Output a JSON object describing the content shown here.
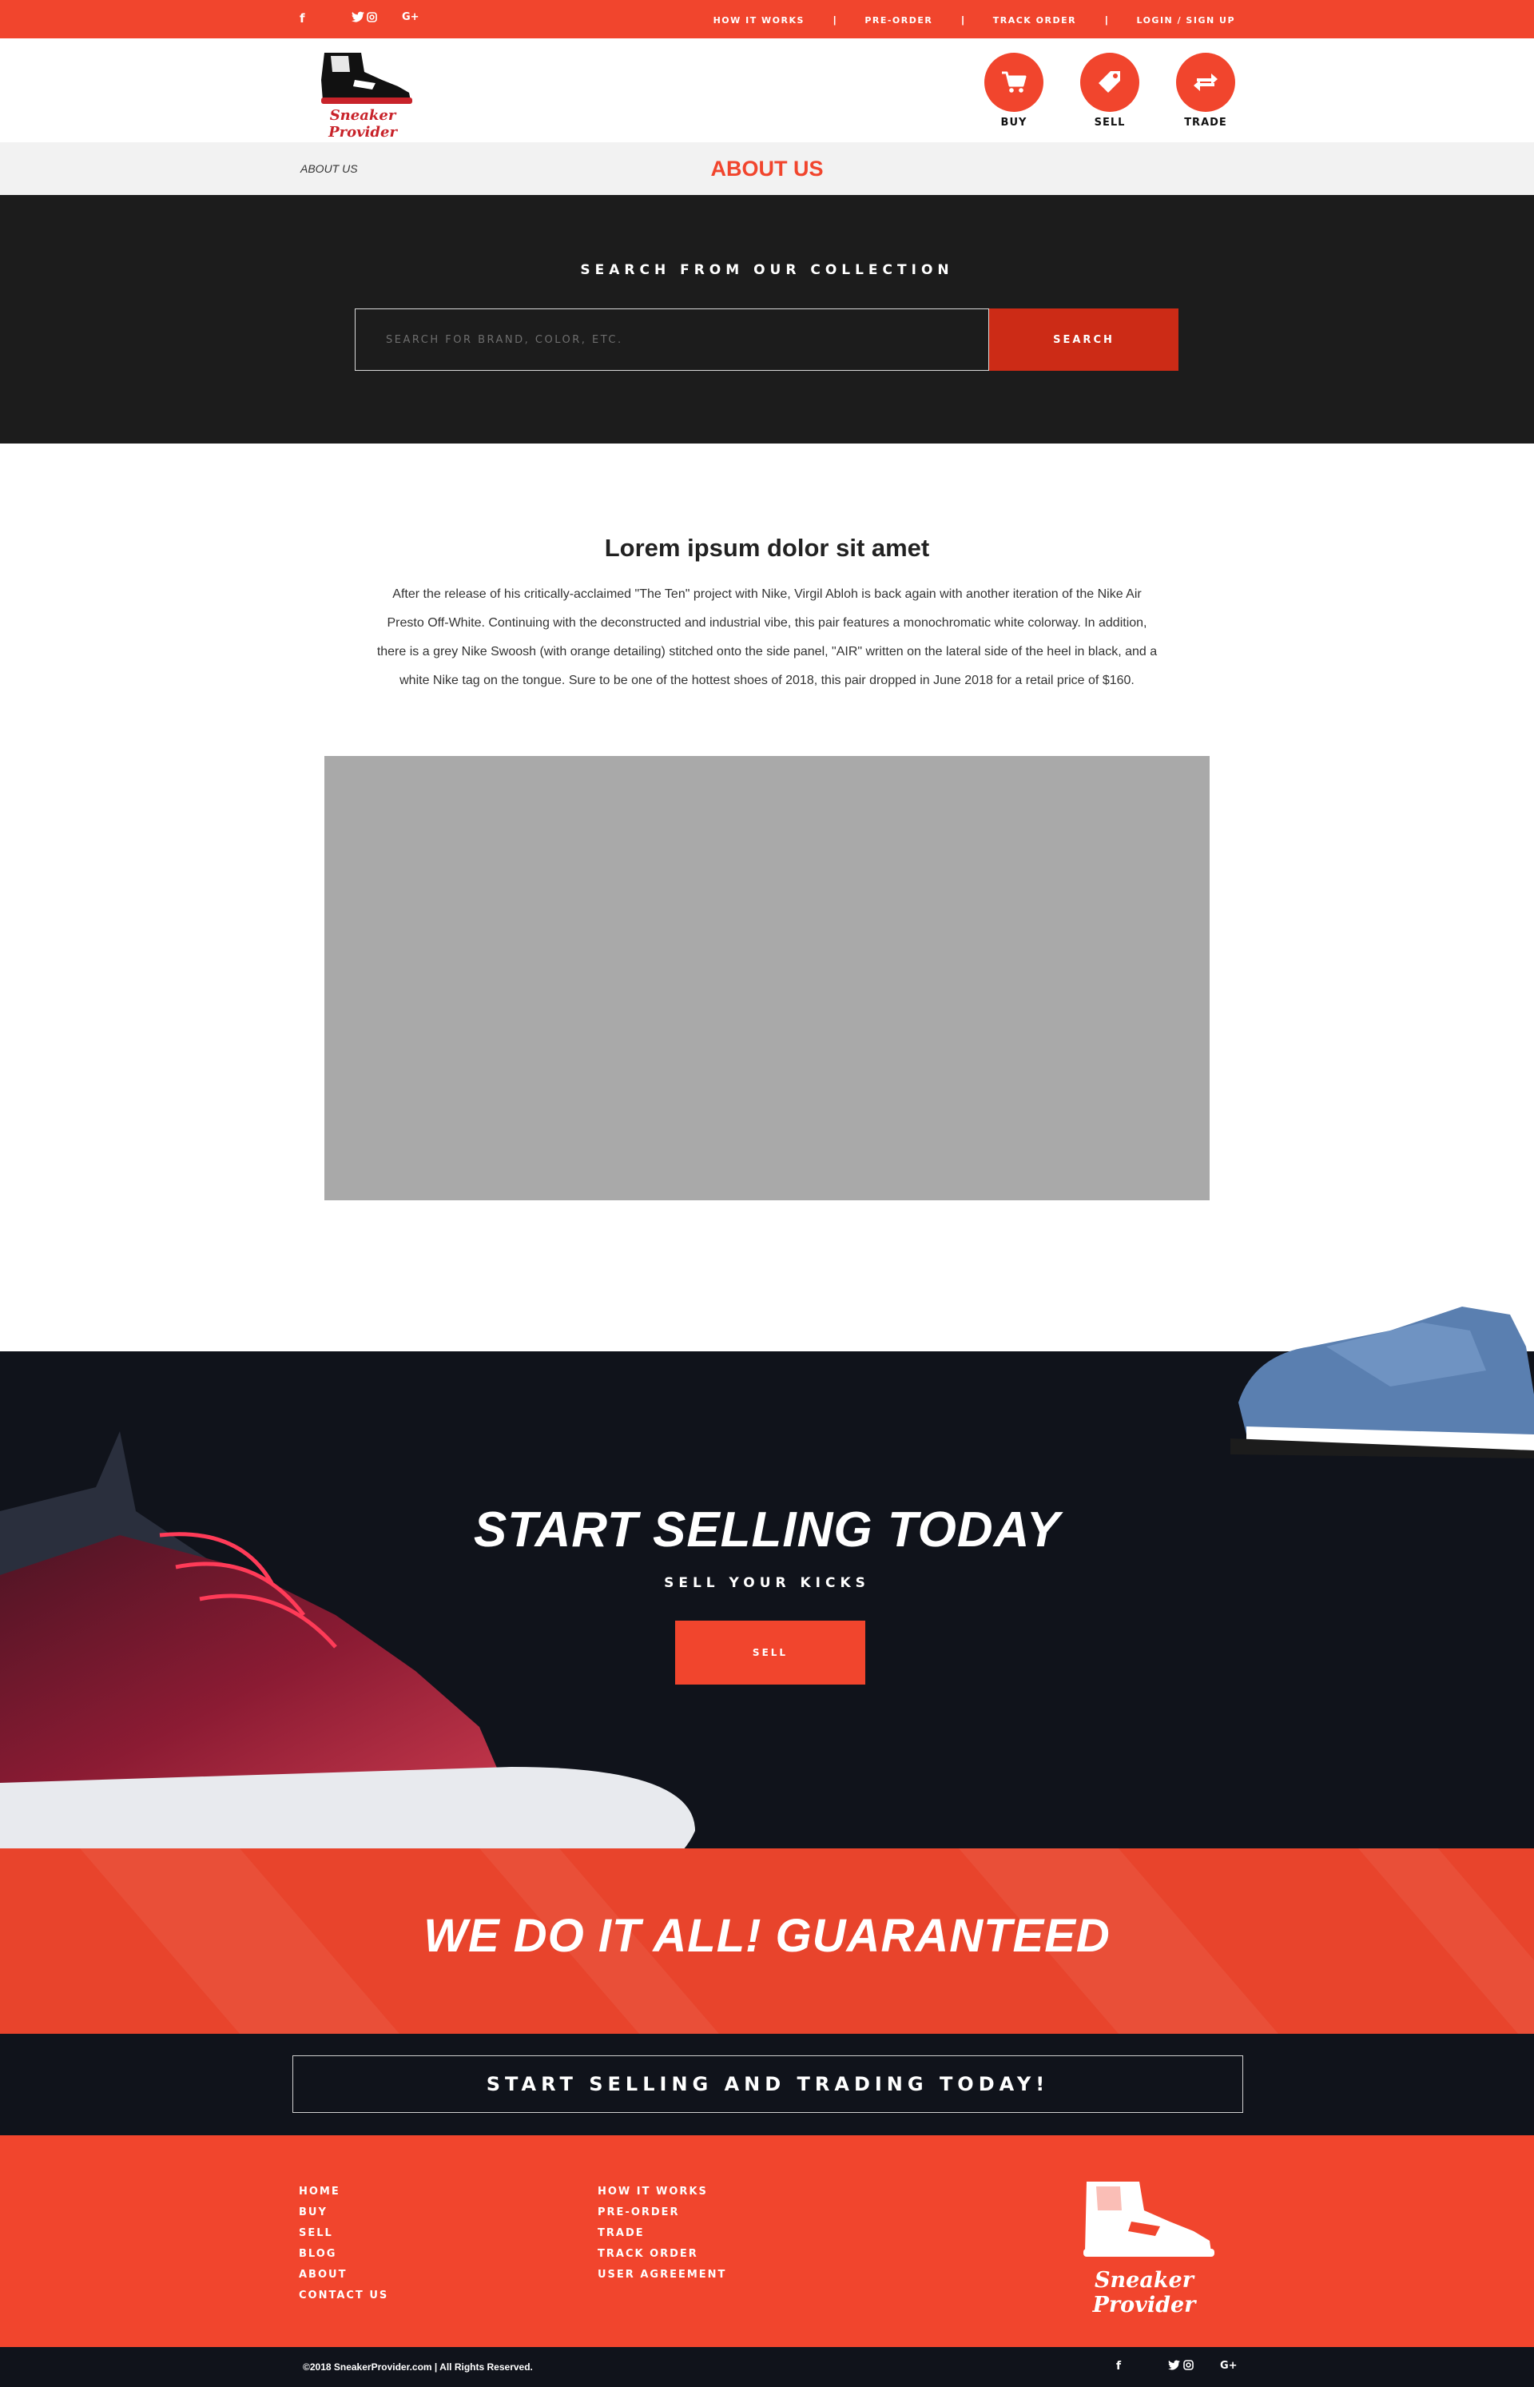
{
  "topbar": {
    "social": {
      "facebook": "f",
      "twitter": "🐦",
      "instagram": "◎",
      "googleplus": "G+"
    },
    "links": [
      "HOW IT WORKS",
      "PRE-ORDER",
      "TRACK ORDER",
      "LOGIN / SIGN UP"
    ],
    "separator": "|"
  },
  "header": {
    "logo_text": "Sneaker Provider",
    "nav": [
      {
        "label": "BUY",
        "icon": "cart-icon"
      },
      {
        "label": "SELL",
        "icon": "tag-icon"
      },
      {
        "label": "TRADE",
        "icon": "exchange-icon"
      }
    ]
  },
  "breadcrumb": {
    "current": "ABOUT US",
    "page_title": "ABOUT US"
  },
  "search": {
    "title": "SEARCH FROM OUR COLLECTION",
    "placeholder": "SEARCH FOR BRAND, COLOR, ETC.",
    "value": "",
    "button": "SEARCH"
  },
  "content": {
    "title": "Lorem ipsum dolor sit amet",
    "body": "After the release of his critically-acclaimed \"The Ten\" project with Nike, Virgil Abloh is back again with another iteration of the Nike Air Presto Off-White. Continuing with the deconstructed and industrial vibe, this pair features a monochromatic white colorway. In addition, there is a grey Nike Swoosh (with orange detailing) stitched onto the side panel, \"AIR\" written on the lateral side of the heel in black, and a white Nike tag on the tongue. Sure to be one of the hottest shoes of 2018, this pair dropped in June 2018 for a retail price of $160."
  },
  "sell": {
    "heading": "START SELLING TODAY",
    "subheading": "SELL YOUR KICKS",
    "button": "SELL"
  },
  "guarantee": {
    "text": "WE DO IT ALL! GUARANTEED"
  },
  "cta": {
    "label": "START SELLING AND TRADING TODAY!"
  },
  "footer": {
    "col1": [
      "HOME",
      "BUY",
      "SELL",
      "BLOG",
      "ABOUT",
      "CONTACT US"
    ],
    "col2": [
      "HOW IT WORKS",
      "PRE-ORDER",
      "TRADE",
      "TRACK ORDER",
      "USER AGREEMENT"
    ],
    "logo_text": "Sneaker Provider",
    "copyright": "©2018 SneakerProvider.com   |   All Rights Reserved."
  },
  "colors": {
    "brand": "#f1452d",
    "dark": "#10131b",
    "search_bg": "#1c1c1c",
    "search_btn": "#cc2b16"
  }
}
